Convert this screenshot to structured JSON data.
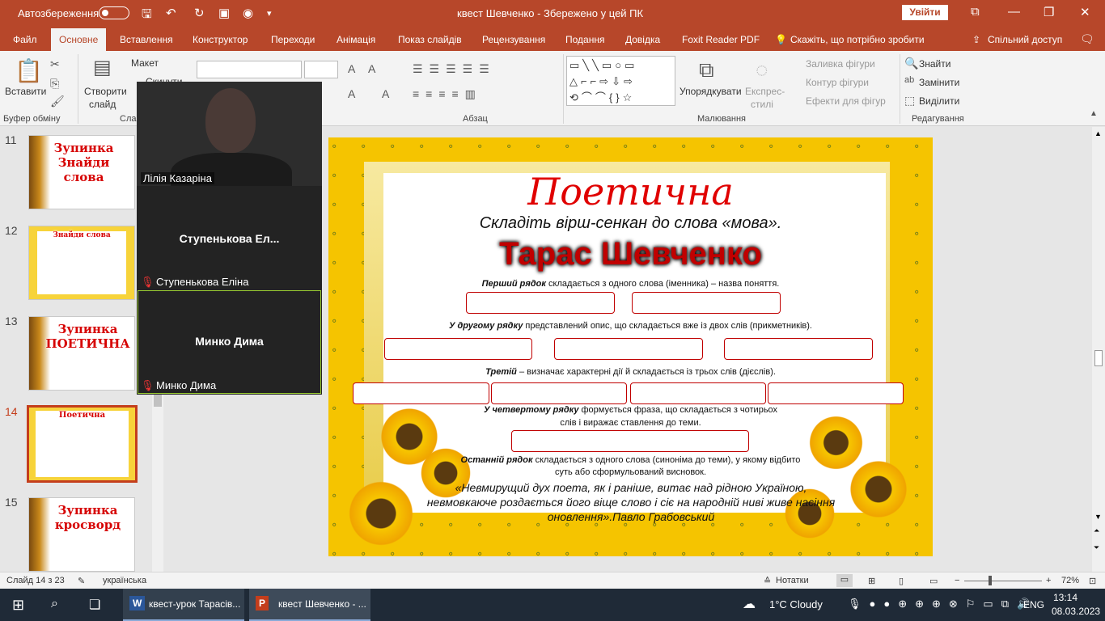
{
  "titlebar": {
    "autosave_label": "Автозбереження",
    "doc_title": "квест Шевченко  -  Збережено у цей ПК",
    "signin_label": "Увійти"
  },
  "tabs": [
    "Файл",
    "Основне",
    "Вставлення",
    "Конструктор",
    "Переходи",
    "Анімація",
    "Показ слайдів",
    "Рецензування",
    "Подання",
    "Довідка",
    "Foxit Reader PDF",
    "Скажіть, що потрібно зробити",
    "Спільний доступ"
  ],
  "ribbon": {
    "paste": "Вставити",
    "new_slide": "Створити",
    "new_slide2": "слайд",
    "layout": "Макет",
    "reset": "Скинути",
    "arrange": "Упорядкувати",
    "quick_styles": "Експрес-",
    "quick_styles2": "стилі",
    "fill": "Заливка фігури",
    "outline": "Контур фігури",
    "effects": "Ефекти для фігур",
    "find": "Знайти",
    "replace": "Замінити",
    "select": "Виділити",
    "groups": {
      "clipboard": "Буфер обміну",
      "slides": "Сла",
      "paragraph": "Абзац",
      "drawing": "Малювання",
      "editing": "Редагування"
    }
  },
  "thumbnails": [
    {
      "num": "11",
      "label": "Зупинка Знайди слова"
    },
    {
      "num": "12",
      "label": "Знайди слова"
    },
    {
      "num": "13",
      "label": "Зупинка ПОЕТИЧНА"
    },
    {
      "num": "14",
      "label": "Поетична"
    },
    {
      "num": "15",
      "label": "Зупинка кросворд"
    }
  ],
  "video": {
    "p1": "Лілія Казаріна",
    "p2_big": "Ступенькова  Ел...",
    "p2": "Ступенькова Еліна",
    "p3_big": "Минко Дима",
    "p3": "Минко Дима"
  },
  "slide": {
    "title": "Поетична",
    "subtitle": "Складіть вірш-сенкан до слова «мова».",
    "name": "Тарас Шевченко",
    "l1b": "Перший рядок",
    "l1": " складається з одного слова (іменника) – назва поняття.",
    "l2b": "У другому рядку",
    "l2": " представлений опис, що складається вже із двох слів (прикметників).",
    "l3b": "Третій",
    "l3": " – визначає характерні дії й складається із трьох слів (дієслів).",
    "l4b": "У четвертому рядку",
    "l4": " формується фраза, що складається з чотирьох",
    "l4c": "слів і виражає ставлення до теми.",
    "l5b": "Останній рядок",
    "l5": " складається з одного слова (синоніма до теми), у якому відбито",
    "l5c": "суть або сформульований висновок.",
    "quote": "«Невмирущий дух поета, як і раніше, витає над рідною Україною, невмовкаюче роздається його віще слово і сіє на народній ниві живе насіння оновлення».Павло Грабовський"
  },
  "status": {
    "slide_of": "Слайд 14 з 23",
    "lang": "українська",
    "notes": "Нотатки",
    "zoom": "72%"
  },
  "taskbar": {
    "app1": "квест-урок Тарасів...",
    "app2": "квест Шевченко - ...",
    "weather": "1°C  Cloudy",
    "lang": "ENG",
    "time": "13:14",
    "date": "08.03.2023"
  }
}
